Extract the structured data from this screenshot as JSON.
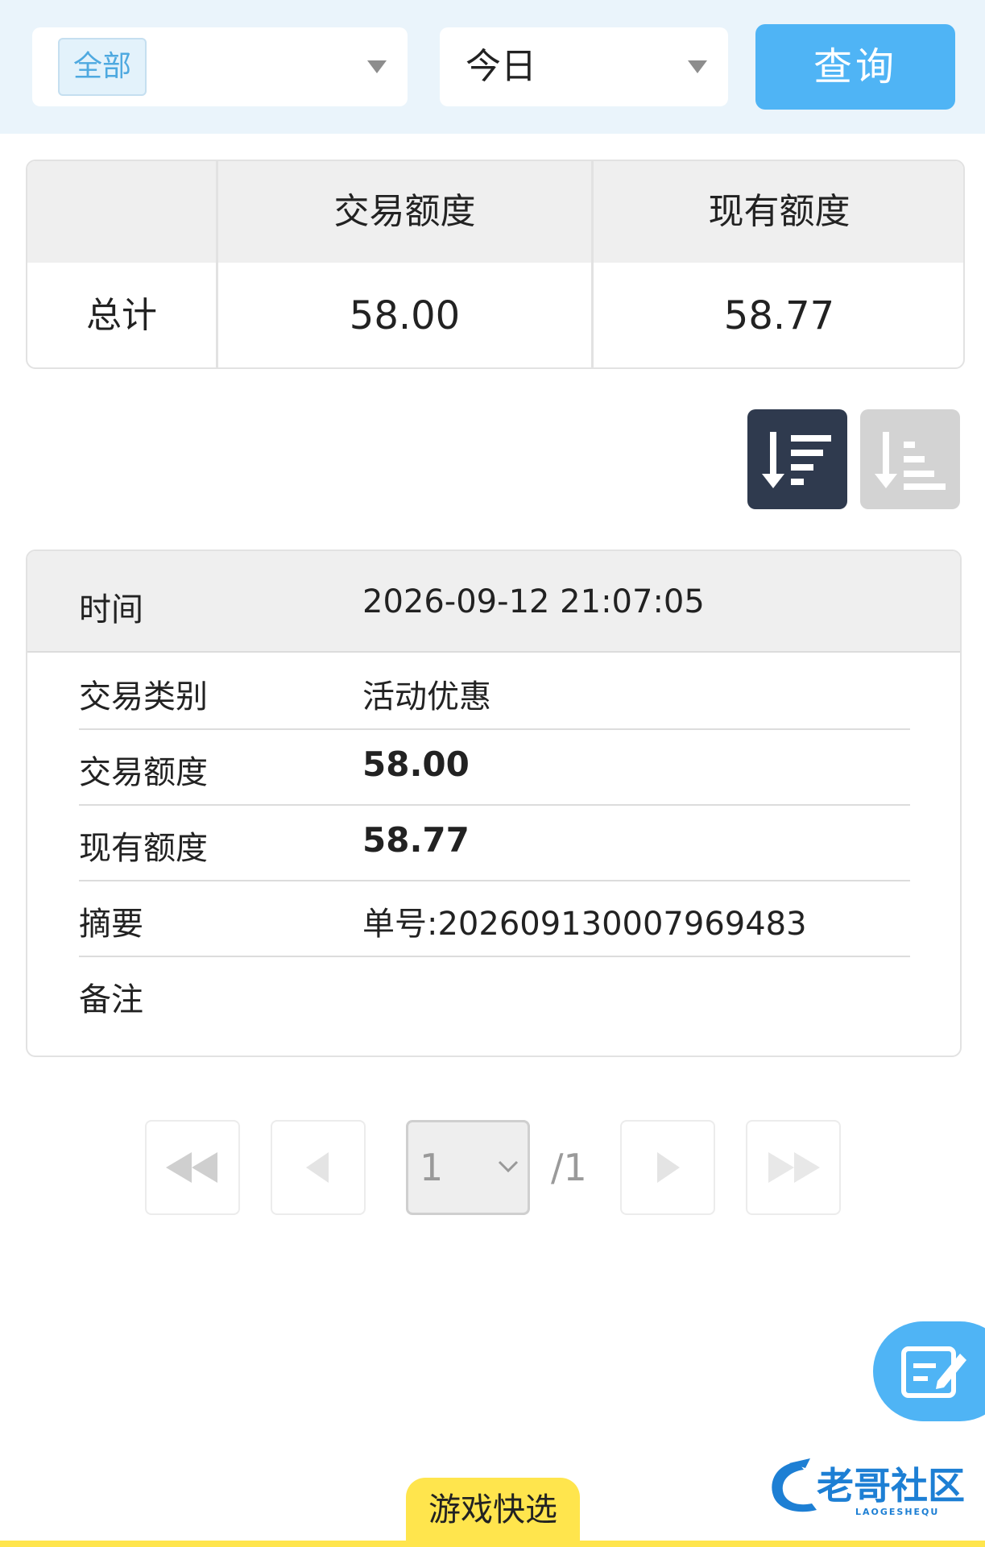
{
  "filters": {
    "type_chip": "全部",
    "date_value": "今日",
    "query_label": "查询"
  },
  "summary": {
    "headers": [
      "",
      "交易额度",
      "现有额度"
    ],
    "row_label": "总计",
    "trade_amount": "58.00",
    "balance": "58.77"
  },
  "detail": {
    "time_label": "时间",
    "time_value": "2026-09-12 21:07:05",
    "rows": [
      {
        "label": "交易类别",
        "value": "活动优惠"
      },
      {
        "label": "交易额度",
        "value": "58.00"
      },
      {
        "label": "现有额度",
        "value": "58.77"
      },
      {
        "label": "摘要",
        "value": "单号:202609130007969483"
      },
      {
        "label": "备注",
        "value": ""
      }
    ]
  },
  "pagination": {
    "current_page": "1",
    "total": "/1"
  },
  "bottom": {
    "quick_tab_label": "游戏快选",
    "watermark_text": "老哥社区",
    "watermark_sub": "LAOGESHEQU"
  },
  "colors": {
    "accent": "#4fb4f5",
    "filter_bg": "#eaf4fb",
    "sort_active": "#2f3a4e",
    "sort_inactive": "#d3d3d3",
    "quick_tab": "#ffe54d"
  },
  "icons": {
    "select_caret": "caret-down-icon",
    "sort_desc": "sort-descending-icon",
    "sort_asc": "sort-ascending-icon",
    "first": "first-page-icon",
    "prev": "prev-page-icon",
    "next": "next-page-icon",
    "last": "last-page-icon",
    "edit": "edit-note-icon"
  }
}
